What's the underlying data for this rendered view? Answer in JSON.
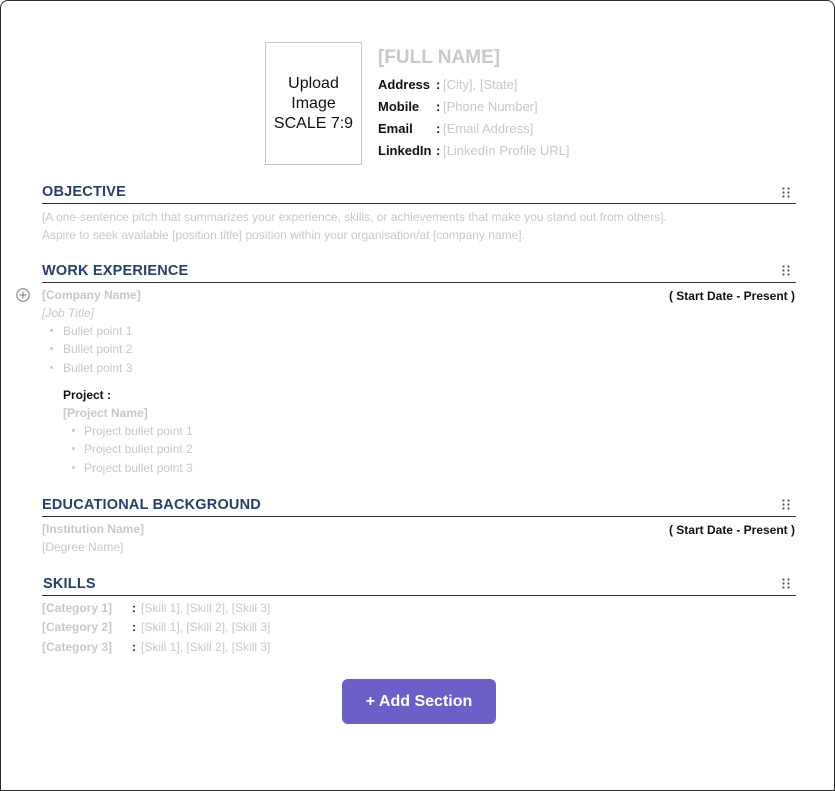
{
  "header": {
    "photo_lines": [
      "Upload",
      "Image",
      "SCALE 7:9"
    ],
    "full_name": "[FULL NAME]",
    "contacts": [
      {
        "label": "Address",
        "value": "[City], [State]"
      },
      {
        "label": "Mobile",
        "value": "[Phone Number]"
      },
      {
        "label": "Email",
        "value": "[Email Address]"
      },
      {
        "label": "LinkedIn",
        "value": "[LinkedIn Profile URL]"
      }
    ],
    "separator": ":"
  },
  "objective": {
    "title": "OBJECTIVE",
    "text": "[A one-sentence pitch that summarizes your experience, skills, or achievements that make you stand out from others]. Aspire to seek available [position title] position within your organisation/at [company name]."
  },
  "work": {
    "title": "WORK EXPERIENCE",
    "company": "[Company Name]",
    "date_range": "( Start Date - Present )",
    "job_title": "[Job Title]",
    "bullets": [
      "Bullet point 1",
      "Bullet point 2",
      "Bullet point 3"
    ],
    "project_label": "Project :",
    "project_name": "[Project Name]",
    "project_bullets": [
      "Project bullet point 1",
      "Project bullet point 2",
      "Project bullet point 3"
    ]
  },
  "education": {
    "title": "EDUCATIONAL BACKGROUND",
    "institution": "[Institution Name]",
    "date_range": "( Start Date - Present )",
    "degree": "[Degree Name]"
  },
  "skills": {
    "title": "SKILLS",
    "separator": ":",
    "rows": [
      {
        "category": "[Category 1]",
        "items": "[Skill 1], [Skill 2], [Skill 3]"
      },
      {
        "category": "[Category 2]",
        "items": "[Skill 1], [Skill 2], [Skill 3]"
      },
      {
        "category": "[Category 3]",
        "items": "[Skill 1], [Skill 2], [Skill 3]"
      }
    ]
  },
  "add_section_label": "+ Add Section",
  "icons": {
    "drag": "drag-handle-icon",
    "add": "plus-circle-icon"
  },
  "colors": {
    "section_title": "#25406b",
    "placeholder": "#c8c8c8",
    "button": "#6c5fc7"
  }
}
